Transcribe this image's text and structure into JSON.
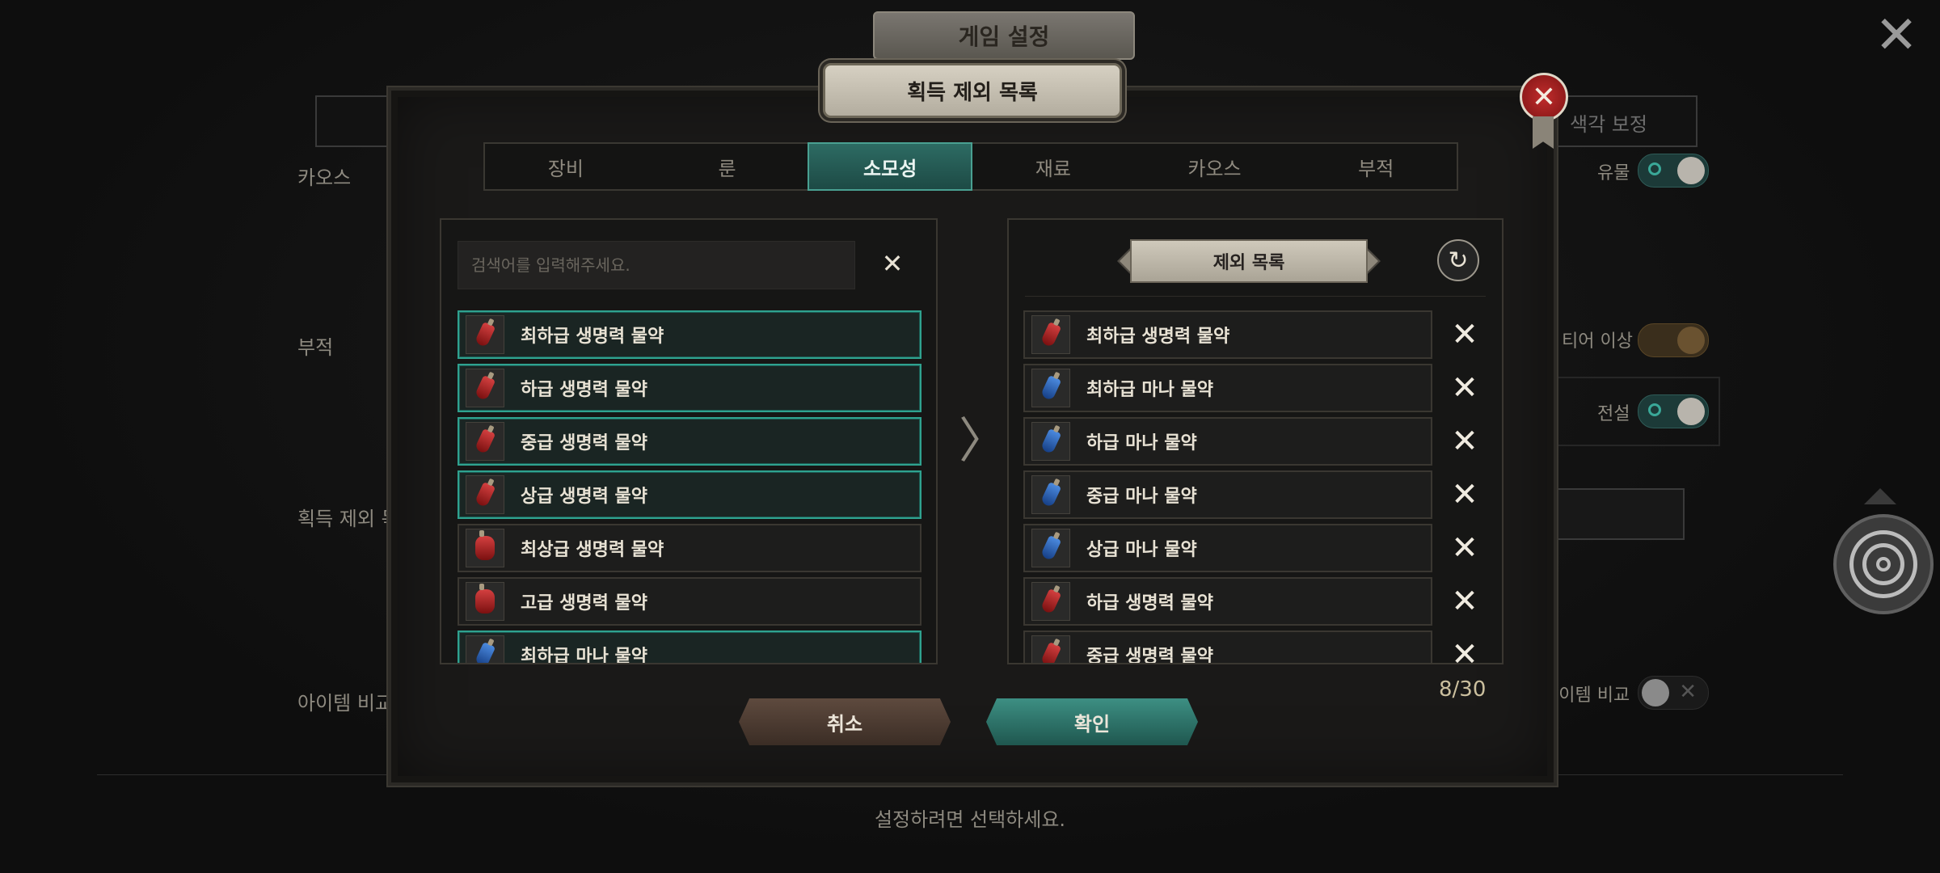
{
  "background": {
    "title": "게임 설정",
    "top_right_option": "색각 보정",
    "left_labels": [
      "카오스",
      "부적",
      "획득 제외 목",
      "아이템 비교"
    ],
    "right_labels": [
      "유물",
      "티어 이상",
      "전설",
      "아이템 비교"
    ],
    "hint": "설정하려면 선택하세요."
  },
  "modal": {
    "title": "획득 제외 목록",
    "tabs": [
      "장비",
      "룬",
      "소모성",
      "재료",
      "카오스",
      "부적"
    ],
    "active_tab": "소모성",
    "search": {
      "placeholder": "검색어를 입력해주세요."
    },
    "items": [
      {
        "label": "최하급 생명력 물약",
        "color": "red",
        "selected": true
      },
      {
        "label": "하급 생명력 물약",
        "color": "red",
        "selected": true
      },
      {
        "label": "중급 생명력 물약",
        "color": "red",
        "selected": true
      },
      {
        "label": "상급 생명력 물약",
        "color": "red",
        "selected": true
      },
      {
        "label": "최상급 생명력 물약",
        "color": "red",
        "selected": false
      },
      {
        "label": "고급 생명력 물약",
        "color": "red",
        "selected": false
      },
      {
        "label": "최하급 마나 물약",
        "color": "blue",
        "selected": true
      }
    ],
    "exclusion_header": "제외 목록",
    "exclusions": [
      {
        "label": "최하급 생명력 물약",
        "color": "red"
      },
      {
        "label": "최하급 마나 물약",
        "color": "blue"
      },
      {
        "label": "하급 마나 물약",
        "color": "blue"
      },
      {
        "label": "중급 마나 물약",
        "color": "blue"
      },
      {
        "label": "상급 마나 물약",
        "color": "blue"
      },
      {
        "label": "하급 생명력 물약",
        "color": "red"
      },
      {
        "label": "중급 생명력 물약",
        "color": "red"
      }
    ],
    "count": "8/30",
    "cancel_label": "취소",
    "confirm_label": "확인"
  },
  "colors": {
    "accent": "#2fa28f",
    "confirm": "#3d8f83",
    "cancel": "#5e4a3e",
    "close": "#c12c2c"
  },
  "icons": [
    "close-icon",
    "search-clear-icon",
    "refresh-icon",
    "chevron-right-icon",
    "remove-x-icon",
    "target-icon",
    "potion-icon"
  ]
}
